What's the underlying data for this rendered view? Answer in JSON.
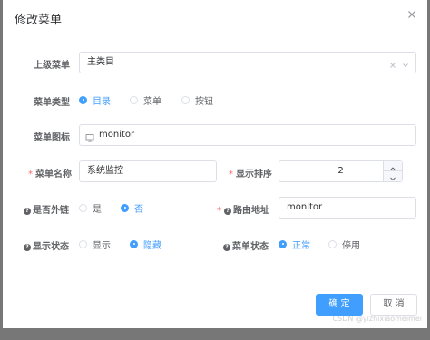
{
  "dialog": {
    "title": "修改菜单"
  },
  "form": {
    "parent": {
      "label": "上级菜单",
      "value": "主类目"
    },
    "menu_type": {
      "label": "菜单类型",
      "options": [
        "目录",
        "菜单",
        "按钮"
      ],
      "selected": "目录"
    },
    "menu_icon": {
      "label": "菜单图标",
      "value": "monitor"
    },
    "menu_name": {
      "label": "菜单名称",
      "value": "系统监控",
      "required": true
    },
    "sort_order": {
      "label": "显示排序",
      "value": "2",
      "required": true
    },
    "is_external": {
      "label": "是否外链",
      "options": [
        "是",
        "否"
      ],
      "selected": "否"
    },
    "route": {
      "label": "路由地址",
      "value": "monitor",
      "required": true
    },
    "visible": {
      "label": "显示状态",
      "options": [
        "显示",
        "隐藏"
      ],
      "selected": "隐藏"
    },
    "status": {
      "label": "菜单状态",
      "options": [
        "正常",
        "停用"
      ],
      "selected": "正常"
    }
  },
  "buttons": {
    "confirm": "确 定",
    "cancel": "取 消"
  },
  "watermark": "CSDN @yizhixiaomeimei",
  "colors": {
    "primary": "#409eff",
    "danger": "#f56c6c",
    "text": "#606266"
  },
  "icons": {
    "close": "close-icon",
    "clear": "clear-icon",
    "arrow": "chevron-down-icon",
    "menu_icon": "monitor-icon"
  }
}
